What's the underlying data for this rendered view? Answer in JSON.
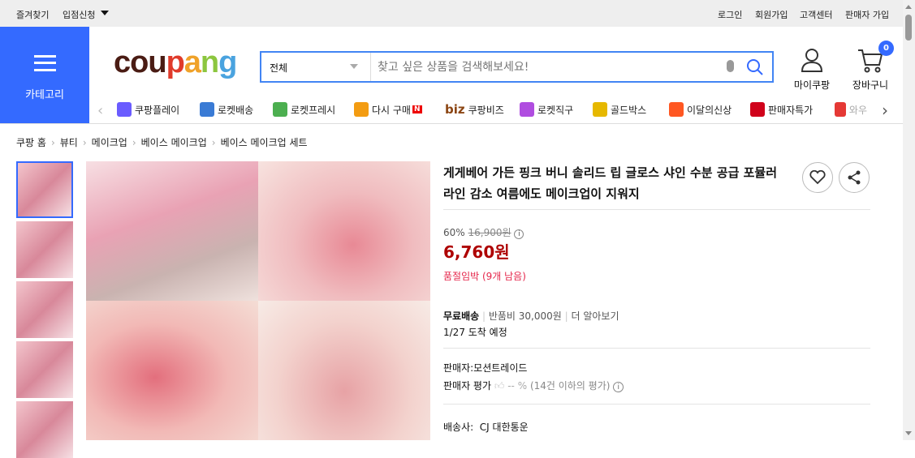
{
  "topbar": {
    "left": [
      "즐겨찾기",
      "입점신청"
    ],
    "right": [
      "로그인",
      "회원가입",
      "고객센터",
      "판매자 가입"
    ]
  },
  "header": {
    "category_label": "카테고리",
    "logo": "coupang",
    "search": {
      "scope": "전체",
      "placeholder": "찾고 싶은 상품을 검색해보세요!"
    },
    "my_coupang": "마이쿠팡",
    "cart": "장바구니",
    "cart_count": "0"
  },
  "nav": [
    {
      "label": "쿠팡플레이",
      "color": "#6a5cff"
    },
    {
      "label": "로켓배송",
      "color": "#3a7bd5"
    },
    {
      "label": "로켓프레시",
      "color": "#4caf50"
    },
    {
      "label": "다시 구매",
      "color": "#f39c12"
    },
    {
      "label": "쿠팡비즈",
      "color": "#8b4513"
    },
    {
      "label": "로켓직구",
      "color": "#b04de0"
    },
    {
      "label": "골드박스",
      "color": "#e6b800"
    },
    {
      "label": "이달의신상",
      "color": "#ff5722"
    },
    {
      "label": "판매자특가",
      "color": "#d0021b"
    },
    {
      "label": "와우",
      "color": "#e53935"
    }
  ],
  "nav_extra": {
    "new_badge": "N",
    "biz": "biz"
  },
  "breadcrumb": [
    "쿠팡 홈",
    "뷰티",
    "메이크업",
    "베이스 메이크업",
    "베이스 메이크업 세트"
  ],
  "product": {
    "title": "게게베어 가든 핑크 버니 솔리드 립 글로스 샤인 수분 공급 포뮬러 라인 감소 여름에도 메이크업이 지워지",
    "discount": "60%",
    "original_price": "16,900원",
    "price": "6,760원",
    "stock": "품절임박 (9개 남음)",
    "shipping": "무료배송",
    "return_fee": "반품비 30,000원",
    "more": "더 알아보기",
    "arrival": "1/27 도착 예정",
    "seller": "판매자:모션트레이드",
    "seller_rating_label": "판매자 평가",
    "seller_rating": "-- %",
    "seller_rating_note": "(14건 이하의 평가)",
    "carrier": "배송사:  CJ 대한통운"
  },
  "colors": {
    "accent": "#346aff",
    "price": "#ae0000",
    "stock": "#e5254a"
  }
}
